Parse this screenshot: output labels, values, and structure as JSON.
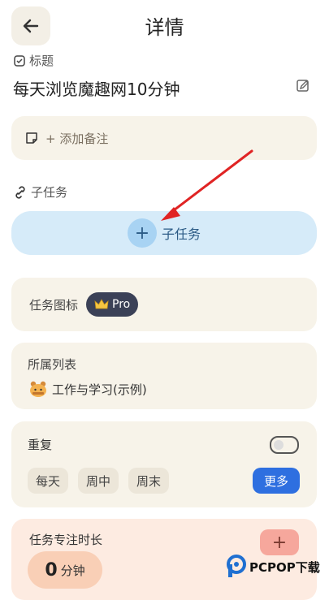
{
  "header": {
    "title": "详情"
  },
  "title_section": {
    "label": "标题",
    "value": "每天浏览魔趣网10分钟"
  },
  "note": {
    "placeholder": "+ 添加备注"
  },
  "subtasks": {
    "label": "子任务",
    "add_label": "子任务",
    "add_icon": "+"
  },
  "task_icon": {
    "label": "任务图标",
    "badge": "Pro"
  },
  "list": {
    "label": "所属列表",
    "value": "工作与学习(示例)"
  },
  "repeat": {
    "label": "重复",
    "options": [
      "每天",
      "周中",
      "周末"
    ],
    "more_label": "更多",
    "enabled": false
  },
  "focus": {
    "label": "任务专注时长",
    "minutes": "0",
    "unit": "分钟",
    "add_icon": "+"
  },
  "watermark": {
    "text": "PCPOP下载"
  },
  "colors": {
    "accent_blue": "#2e6fe0",
    "subtask_bg": "#d6ebf9",
    "card_bg": "#f7f3e9",
    "focus_bg": "#fdebe1",
    "arrow_red": "#e02424"
  }
}
